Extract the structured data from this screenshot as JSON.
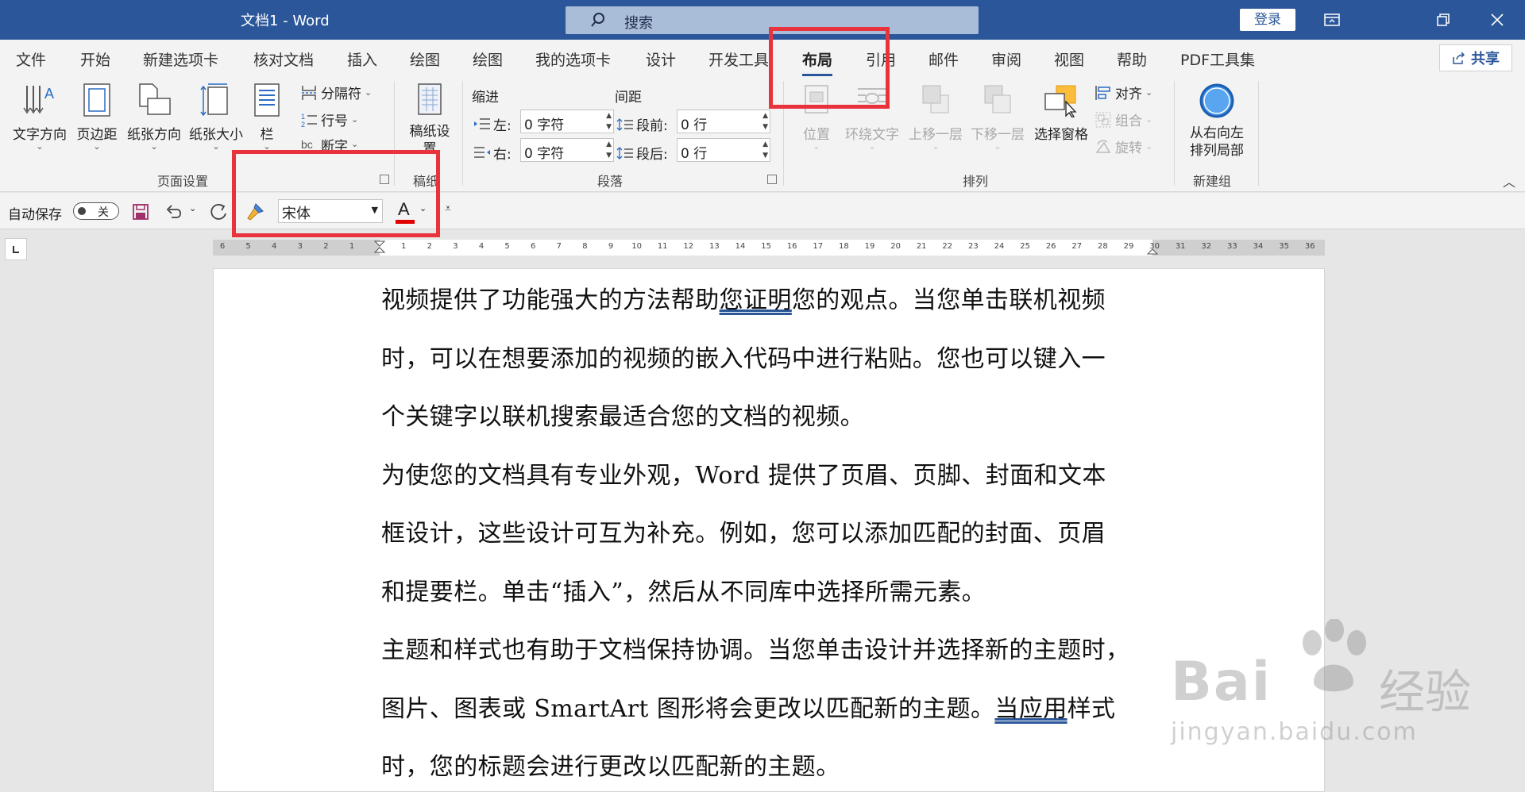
{
  "app": {
    "title": "文档1  -  Word"
  },
  "search": {
    "placeholder": "搜索"
  },
  "titlebar": {
    "login_label": "登录"
  },
  "tabs": [
    "文件",
    "开始",
    "新建选项卡",
    "核对文档",
    "插入",
    "绘图",
    "绘图",
    "我的选项卡",
    "设计",
    "开发工具",
    "布局",
    "引用",
    "邮件",
    "审阅",
    "视图",
    "帮助",
    "PDF工具集"
  ],
  "active_tab": "布局",
  "share": {
    "label": "共享"
  },
  "ribbon": {
    "page_setup": {
      "text_direction": "文字方向",
      "margins": "页边距",
      "orientation": "纸张方向",
      "size": "纸张大小",
      "columns": "栏",
      "breaks": "分隔符",
      "line_numbers": "行号",
      "hyphenation": "断字",
      "group_label": "页面设置"
    },
    "manuscript": {
      "button": "稿纸设置",
      "group_label": "稿纸"
    },
    "paragraph": {
      "indent_title": "缩进",
      "spacing_title": "间距",
      "left_label": "左:",
      "left_value": "0 字符",
      "right_label": "右:",
      "right_value": "0 字符",
      "before_label": "段前:",
      "before_value": "0 行",
      "after_label": "段后:",
      "after_value": "0 行",
      "group_label": "段落"
    },
    "arrange": {
      "position": "位置",
      "wrap_text": "环绕文字",
      "bring_forward": "上移一层",
      "send_backward": "下移一层",
      "selection_pane": "选择窗格",
      "align": "对齐",
      "group": "组合",
      "rotate": "旋转",
      "group_label": "排列"
    },
    "new_group": {
      "button": "从右向左排列局部",
      "group_label": "新建组"
    }
  },
  "qat": {
    "autosave_label": "自动保存",
    "autosave_state": "关",
    "font": "宋体",
    "font_color": "#e00000"
  },
  "ruler": {
    "ticks": [
      "6",
      "5",
      "4",
      "3",
      "2",
      "1",
      "",
      "1",
      "2",
      "3",
      "4",
      "5",
      "6",
      "7",
      "8",
      "9",
      "10",
      "11",
      "12",
      "13",
      "14",
      "15",
      "16",
      "17",
      "18",
      "19",
      "20",
      "21",
      "22",
      "23",
      "24",
      "25",
      "26",
      "27",
      "28",
      "29",
      "30",
      "31",
      "32",
      "33",
      "34",
      "35",
      "36"
    ]
  },
  "document": {
    "lines": [
      {
        "pre": "视频提供了功能强大的方法帮助",
        "ul": "您证明",
        "post": "您的观点。当您单击联机视频"
      },
      {
        "pre": "时，可以在想要添加的视频的嵌入代码中进行粘贴。您也可以键入一",
        "ul": "",
        "post": ""
      },
      {
        "pre": "个关键字以联机搜索最适合您的文档的视频。",
        "ul": "",
        "post": ""
      },
      {
        "pre": "为使您的文档具有专业外观，Word 提供了页眉、页脚、封面和文本",
        "ul": "",
        "post": ""
      },
      {
        "pre": "框设计，这些设计可互为补充。例如，您可以添加匹配的封面、页眉",
        "ul": "",
        "post": ""
      },
      {
        "pre": "和提要栏。单击“插入”，然后从不同库中选择所需元素。",
        "ul": "",
        "post": ""
      },
      {
        "pre": "主题和样式也有助于文档保持协调。当您单击设计并选择新的主题时，",
        "ul": "",
        "post": ""
      },
      {
        "pre": "图片、图表或 SmartArt 图形将会更改以匹配新的主题。",
        "ul": "当应用",
        "post": "样式"
      },
      {
        "pre": "时，您的标题会进行更改以匹配新的主题。",
        "ul": "",
        "post": ""
      }
    ]
  },
  "watermark": {
    "brand": "Bai",
    "brand_cn": "经验",
    "url": "jingyan.baidu.com"
  },
  "colors": {
    "titlebar": "#2b579a",
    "highlight": "#e8333c"
  }
}
